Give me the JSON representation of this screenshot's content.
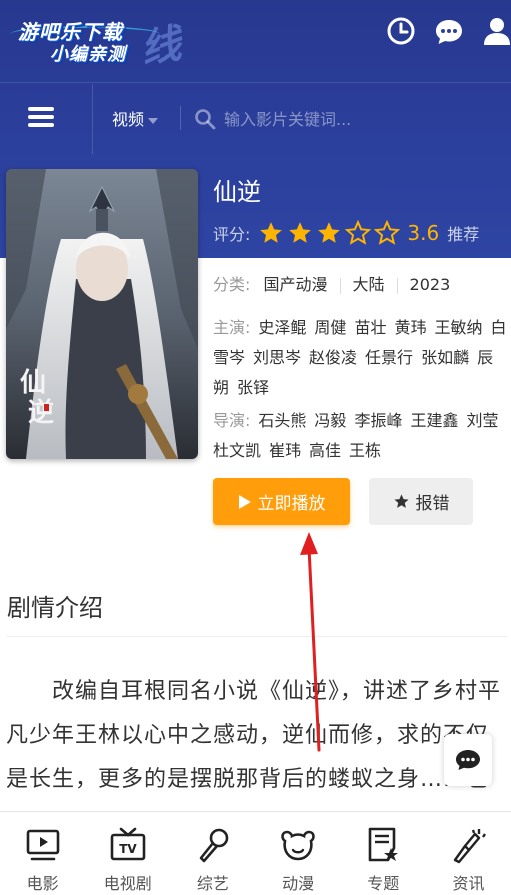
{
  "header": {
    "logo_line1": "游吧乐下载",
    "logo_line2": "小编亲测",
    "logo_mark": "线"
  },
  "navbar": {
    "category": "视频",
    "search_placeholder": "输入影片关键词..."
  },
  "movie": {
    "title": "仙逆",
    "rating_label": "评分:",
    "stars_filled": 3,
    "stars_total": 5,
    "score": "3.6",
    "recommend": "推荐",
    "category_label": "分类:",
    "genre": "国产动漫",
    "region": "大陆",
    "year": "2023",
    "cast_label": "主演:",
    "cast": [
      "史泽鲲",
      "周健",
      "苗壮",
      "黄玮",
      "王敏纳",
      "白雪岑",
      "刘思岑",
      "赵俊凌",
      "任景行",
      "张如麟",
      "辰朔",
      "张铎"
    ],
    "director_label": "导演:",
    "directors": [
      "石头熊",
      "冯毅",
      "李振峰",
      "王建鑫",
      "刘莹",
      "杜文凯",
      "崔玮",
      "高佳",
      "王栋"
    ],
    "play_label": "立即播放",
    "report_label": "报错",
    "poster_text": "仙逆"
  },
  "synopsis": {
    "heading": "剧情介绍",
    "text": "改编自耳根同名小说《仙逆》，讲述了乡村平凡少年王林以心中之感动，逆仙而修，求的不仅是长生，更多的是摆脱那背后的蝼蚁之身……也想的道为"
  },
  "bottom_nav": [
    {
      "label": "电影",
      "icon": "movie-icon"
    },
    {
      "label": "电视剧",
      "icon": "tv-icon"
    },
    {
      "label": "综艺",
      "icon": "microphone-icon"
    },
    {
      "label": "动漫",
      "icon": "bear-icon"
    },
    {
      "label": "专题",
      "icon": "topic-icon"
    },
    {
      "label": "资讯",
      "icon": "news-icon"
    }
  ],
  "colors": {
    "header_bg": "#2b3f9c",
    "accent": "#ff9d0a",
    "star": "#ffb400",
    "annotation": "#e02020"
  }
}
